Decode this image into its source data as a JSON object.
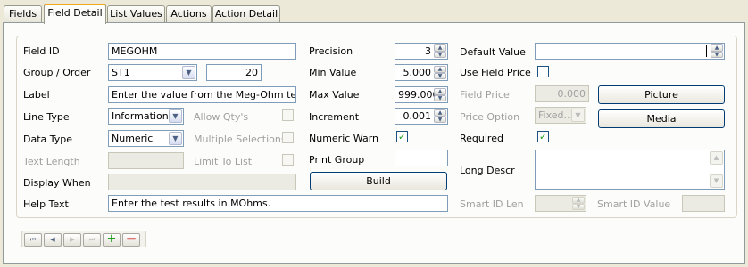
{
  "tabs": [
    {
      "label": "Fields",
      "active": false
    },
    {
      "label": "Field Detail",
      "active": true
    },
    {
      "label": "List Values",
      "active": false
    },
    {
      "label": "Actions",
      "active": false
    },
    {
      "label": "Action Detail",
      "active": false
    }
  ],
  "col1": {
    "field_id": {
      "label": "Field ID",
      "value": "MEGOHM"
    },
    "group_order": {
      "label": "Group / Order",
      "group": "ST1",
      "order": "20"
    },
    "label": {
      "label": "Label",
      "value": "Enter the value from the Meg-Ohm test"
    },
    "line_type": {
      "label": "Line Type",
      "value": "Information"
    },
    "data_type": {
      "label": "Data Type",
      "value": "Numeric"
    },
    "text_length": {
      "label": "Text Length",
      "value": ""
    },
    "display_when": {
      "label": "Display When",
      "value": ""
    },
    "help_text": {
      "label": "Help Text",
      "value": "Enter the test results in MOhms."
    },
    "allow_qty": {
      "label": "Allow Qty's",
      "checked": false
    },
    "multiple_selections": {
      "label": "Multiple Selections",
      "checked": false
    },
    "limit_to_list": {
      "label": "Limit To List",
      "checked": false
    }
  },
  "col2": {
    "precision": {
      "label": "Precision",
      "value": "3"
    },
    "min_value": {
      "label": "Min Value",
      "value": "5.000"
    },
    "max_value": {
      "label": "Max Value",
      "value": "999.000"
    },
    "increment": {
      "label": "Increment",
      "value": "0.001"
    },
    "numeric_warn": {
      "label": "Numeric Warn",
      "checked": true
    },
    "print_group": {
      "label": "Print Group",
      "value": ""
    },
    "build_button": "Build"
  },
  "col3": {
    "default_value": {
      "label": "Default Value",
      "value": ""
    },
    "use_field_price": {
      "label": "Use Field Price",
      "checked": false
    },
    "field_price": {
      "label": "Field Price",
      "value": "0.000"
    },
    "price_option": {
      "label": "Price Option",
      "value": "Fixed..."
    },
    "required": {
      "label": "Required",
      "checked": true
    },
    "long_descr": {
      "label": "Long Descr",
      "value": ""
    },
    "smart_id_len": {
      "label": "Smart ID Len",
      "value": ""
    },
    "smart_id_value": {
      "label": "Smart ID Value",
      "value": ""
    },
    "picture_button": "Picture",
    "media_button": "Media"
  },
  "glyphs": {
    "check": "✓",
    "spin_up": "▲",
    "spin_down": "▼",
    "dropdown": "▼",
    "nav_first": "⏮",
    "nav_prev": "◀",
    "nav_next": "▶",
    "nav_last": "⏭",
    "add": "+",
    "delete": "−"
  },
  "colors": {
    "active_tab_accent": "#f0a81d",
    "check_green": "#21a121",
    "add_green": "#1d9c1d",
    "delete_red": "#cc1212"
  }
}
